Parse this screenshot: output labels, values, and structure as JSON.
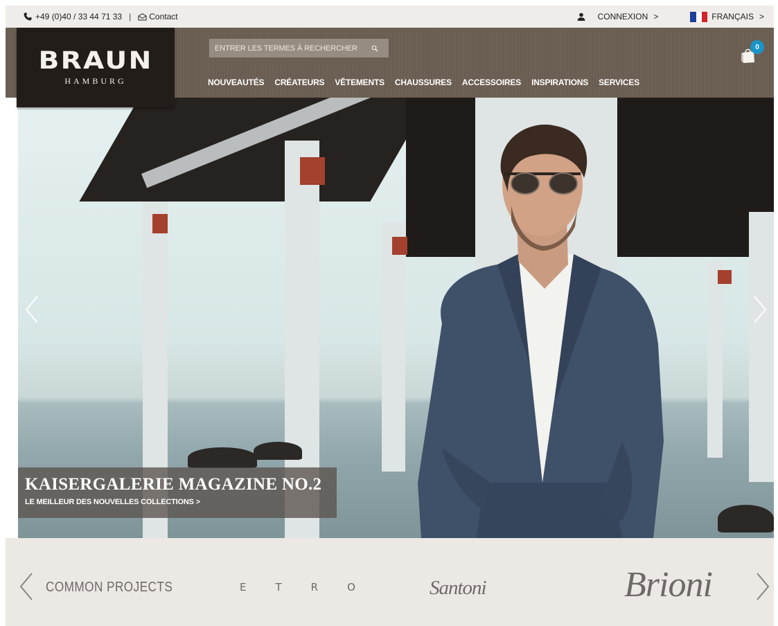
{
  "topbar": {
    "phone": "+49 (0)40 / 33 44 71 33",
    "separator": "|",
    "contact": "Contact",
    "login": "CONNEXION",
    "login_chevron": ">",
    "language": "FRANÇAIS",
    "language_chevron": ">"
  },
  "logo": {
    "brand": "BRAUN",
    "city": "HAMBURG"
  },
  "search": {
    "placeholder": "ENTRER LES TERMES À RECHERCHER"
  },
  "nav": {
    "items": [
      {
        "label": "NOUVEAUTÉS"
      },
      {
        "label": "CRÉATEURS"
      },
      {
        "label": "VÊTEMENTS"
      },
      {
        "label": "CHAUSSURES"
      },
      {
        "label": "ACCESSOIRES"
      },
      {
        "label": "INSPIRATIONS"
      },
      {
        "label": "SERVICES"
      }
    ]
  },
  "cart": {
    "count": "0"
  },
  "hero": {
    "title": "KAISERGALERIE MAGAZINE NO.2",
    "subtitle": "LE MEILLEUR DES NOUVELLES COLLECTIONS >"
  },
  "brands": {
    "items": [
      {
        "label": "COMMON PROJECTS"
      },
      {
        "label": "ETRO"
      },
      {
        "label": "Santoni"
      },
      {
        "label": "Brioni"
      }
    ]
  },
  "colors": {
    "topbar_bg": "#efece9",
    "header_bg": "#6b5e52",
    "logo_bg": "#231d1a",
    "badge": "#1a95c9",
    "brand_strip": "#ece8e4"
  },
  "icons": {
    "phone": "phone-icon",
    "contact": "mail-icon",
    "user": "user-icon",
    "flag": "france-flag-icon",
    "search": "search-icon",
    "cart": "shopping-bag-icon",
    "prev": "chevron-left-icon",
    "next": "chevron-right-icon"
  }
}
